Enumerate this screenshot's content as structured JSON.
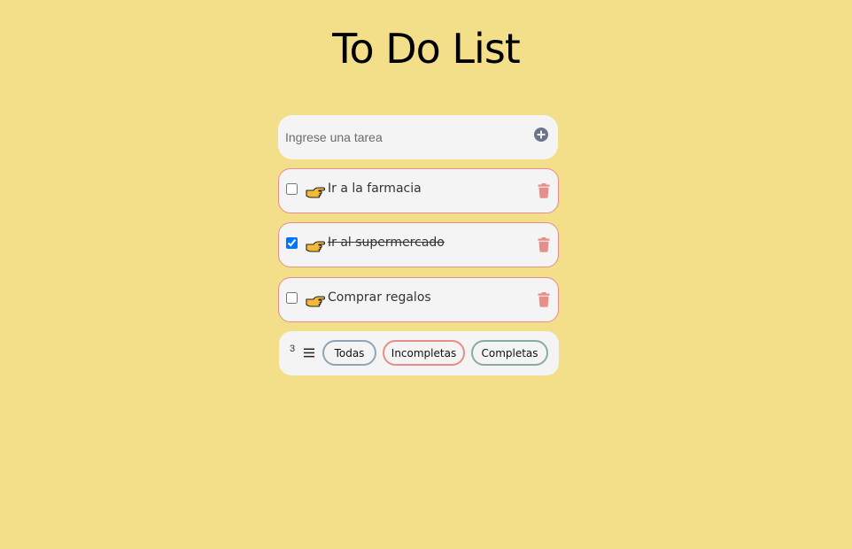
{
  "app": {
    "title": "To Do List"
  },
  "input": {
    "placeholder": "Ingrese una tarea",
    "value": ""
  },
  "tasks": [
    {
      "label": "Ir a la farmacia",
      "checked": false
    },
    {
      "label": "Ir al supermercado",
      "checked": true
    },
    {
      "label": "Comprar regalos",
      "checked": false
    }
  ],
  "footer": {
    "count": "3",
    "filters": [
      "Todas",
      "Incompletas",
      "Completas"
    ]
  },
  "colors": {
    "background": "#f3de89",
    "card": "#f4f4f4",
    "task_border": "#e98c8c",
    "trash": "#e58e8a",
    "add_icon": "#6d748a",
    "filter_all_border": "#8ea4b7",
    "filter_incomplete_border": "#e58e8a",
    "filter_complete_border": "#86ad9f"
  },
  "icons": {
    "add": "plus-circle-icon",
    "task": "pointing-hand-icon",
    "delete": "trash-icon",
    "menu": "hamburger-menu-icon"
  }
}
